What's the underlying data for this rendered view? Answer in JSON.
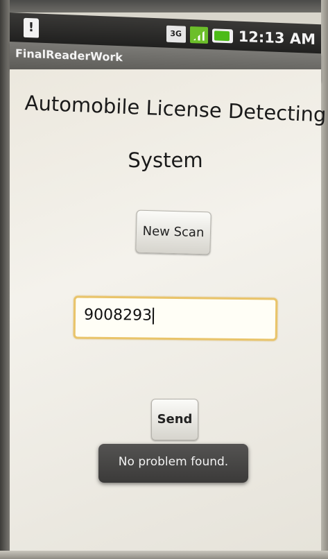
{
  "status_bar": {
    "network": "3G",
    "time": "12:13 AM"
  },
  "app": {
    "title": "FinalReaderWork"
  },
  "main": {
    "headline_line1": "Automobile License Detecting",
    "headline_line2": "System",
    "scan_button": "New Scan",
    "plate_input": "9008293",
    "send_button": "Send",
    "toast": "No problem found."
  }
}
